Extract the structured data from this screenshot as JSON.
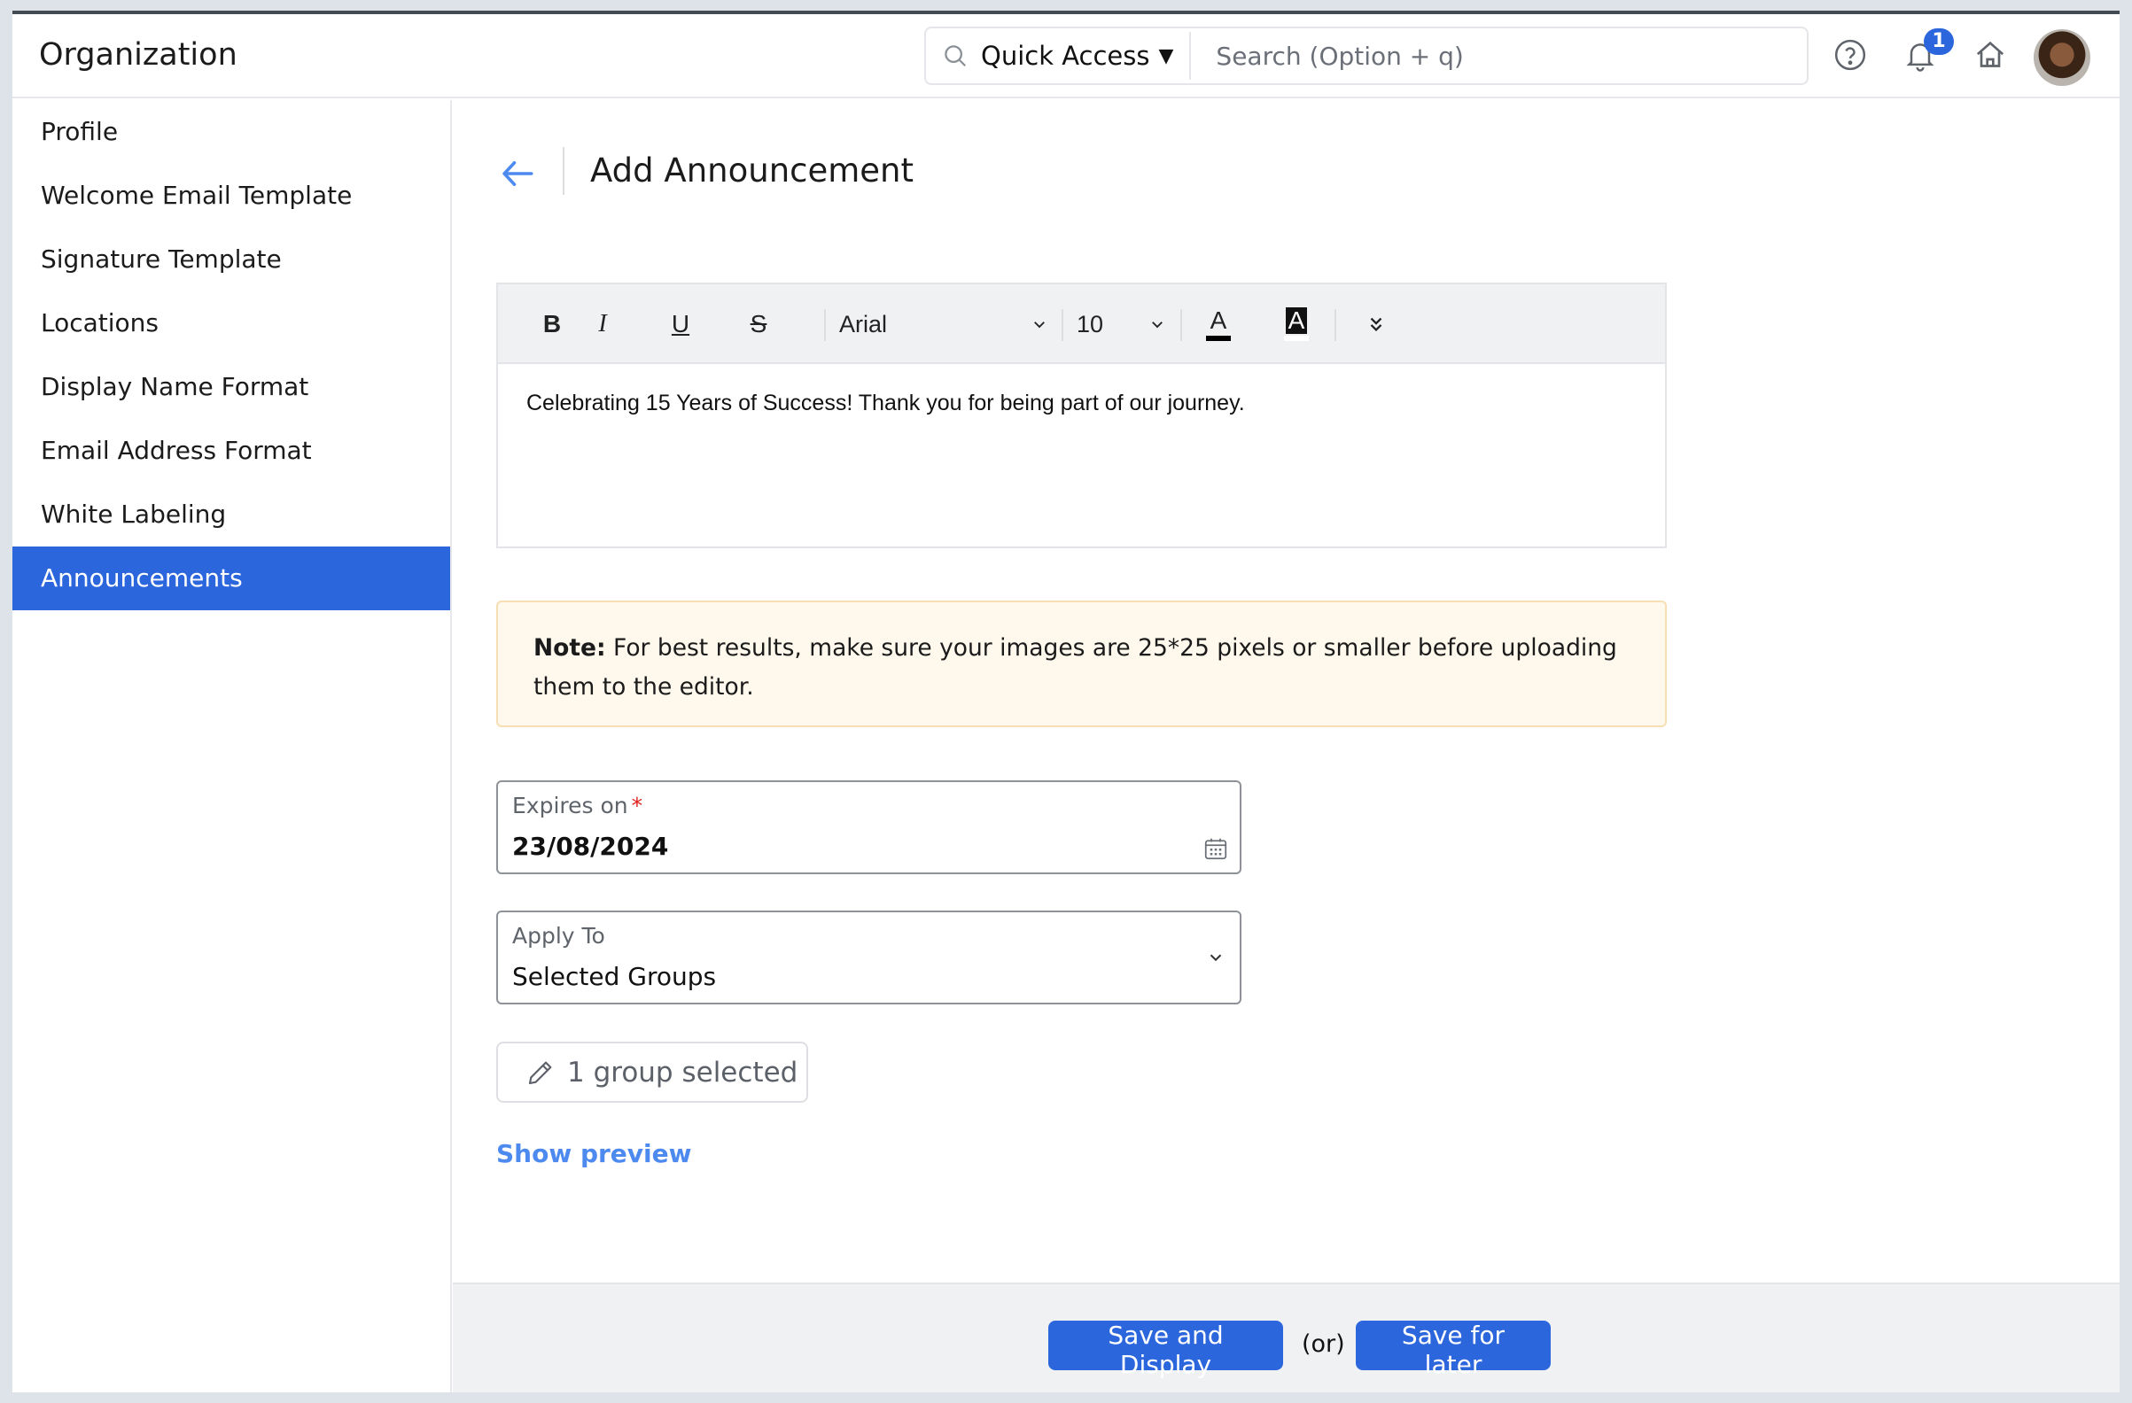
{
  "header": {
    "app_title": "Organization",
    "quick_access_label": "Quick Access",
    "search_placeholder": "Search (Option + q)",
    "notification_count": "1",
    "icons": [
      "search-icon",
      "help-icon",
      "bell-icon",
      "home-icon",
      "avatar"
    ]
  },
  "sidebar": {
    "items": [
      {
        "label": "Profile",
        "active": false
      },
      {
        "label": "Welcome Email Template",
        "active": false
      },
      {
        "label": "Signature Template",
        "active": false
      },
      {
        "label": "Locations",
        "active": false
      },
      {
        "label": "Display Name Format",
        "active": false
      },
      {
        "label": "Email Address Format",
        "active": false
      },
      {
        "label": "White Labeling",
        "active": false
      },
      {
        "label": "Announcements",
        "active": true
      }
    ]
  },
  "main": {
    "page_title": "Add Announcement",
    "editor": {
      "toolbar": {
        "bold": "B",
        "italic": "I",
        "underline": "U",
        "strikethrough": "S",
        "font_family": "Arial",
        "font_size": "10",
        "text_color_label": "A",
        "highlight_label": "A"
      },
      "content": "Celebrating 15 Years of Success! Thank you for being part of our journey."
    },
    "note": {
      "label": "Note:",
      "text": " For best results, make sure your images are 25*25 pixels or smaller before uploading them to the editor."
    },
    "expires_on": {
      "label": "Expires on",
      "required_marker": "*",
      "value": "23/08/2024"
    },
    "apply_to": {
      "label": "Apply To",
      "value": "Selected Groups"
    },
    "group_selection": "1 group selected",
    "show_preview": "Show preview"
  },
  "footer": {
    "save_and_display": "Save and Display",
    "or": "(or)",
    "save_for_later": "Save for later"
  },
  "colors": {
    "accent": "#2c66dd",
    "link": "#4d8af0",
    "note_bg": "#fff8ec",
    "note_border": "#f7deb3",
    "required": "#e0201c"
  }
}
